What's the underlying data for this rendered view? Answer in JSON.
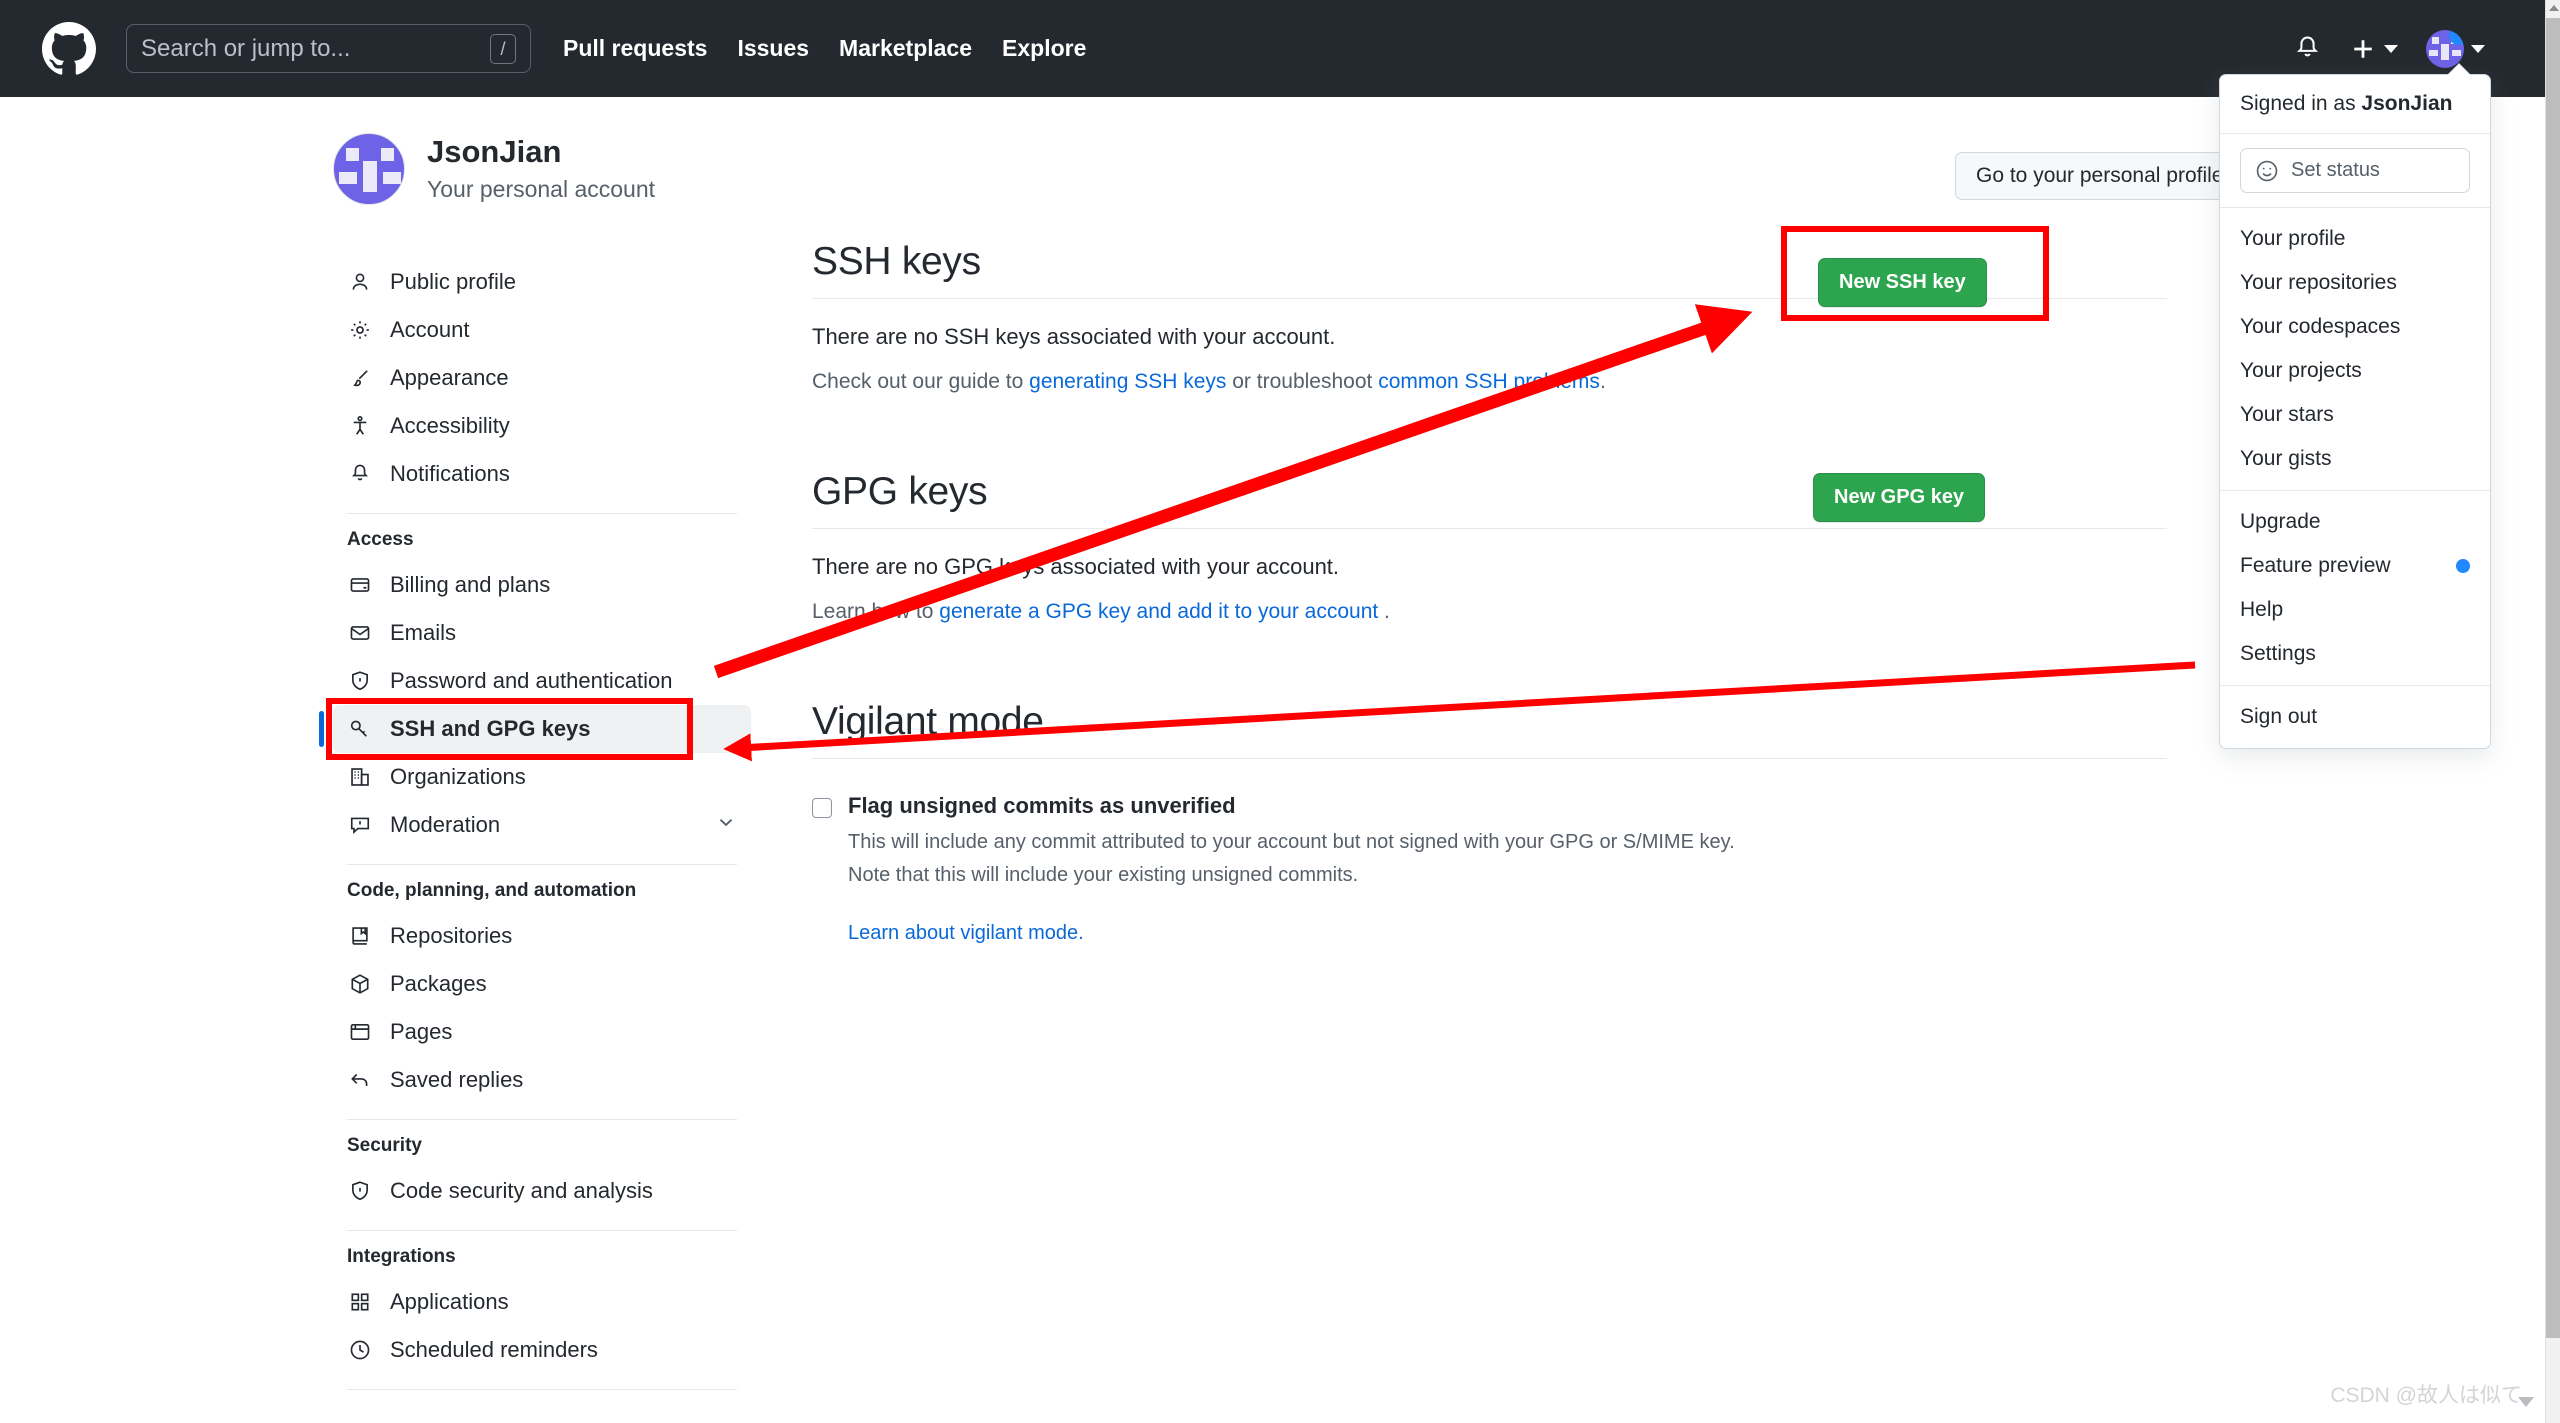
{
  "header": {
    "logo_icon": "github-logo-icon",
    "search": {
      "placeholder": "Search or jump to...",
      "shortcut": "/"
    },
    "nav": [
      {
        "label": "Pull requests"
      },
      {
        "label": "Issues"
      },
      {
        "label": "Marketplace"
      },
      {
        "label": "Explore"
      }
    ],
    "notifications_icon": "bell-icon",
    "create_new_icon": "plus-icon",
    "avatar_icon": "avatar"
  },
  "profile": {
    "name": "JsonJian",
    "subtitle": "Your personal account",
    "goto_profile_label": "Go to your personal profile"
  },
  "sidebar": {
    "top_items": [
      {
        "label": "Public profile",
        "icon": "person-icon"
      },
      {
        "label": "Account",
        "icon": "gear-icon"
      },
      {
        "label": "Appearance",
        "icon": "paintbrush-icon"
      },
      {
        "label": "Accessibility",
        "icon": "accessibility-icon"
      },
      {
        "label": "Notifications",
        "icon": "bell-icon"
      }
    ],
    "groups": [
      {
        "title": "Access",
        "items": [
          {
            "label": "Billing and plans",
            "icon": "credit-card-icon",
            "active": false
          },
          {
            "label": "Emails",
            "icon": "mail-icon",
            "active": false
          },
          {
            "label": "Password and authentication",
            "icon": "shield-lock-icon",
            "active": false
          },
          {
            "label": "SSH and GPG keys",
            "icon": "key-icon",
            "active": true
          },
          {
            "label": "Organizations",
            "icon": "organization-icon",
            "active": false
          },
          {
            "label": "Moderation",
            "icon": "report-icon",
            "active": false,
            "chevron": true
          }
        ]
      },
      {
        "title": "Code, planning, and automation",
        "items": [
          {
            "label": "Repositories",
            "icon": "repo-icon",
            "active": false
          },
          {
            "label": "Packages",
            "icon": "package-icon",
            "active": false
          },
          {
            "label": "Pages",
            "icon": "browser-icon",
            "active": false
          },
          {
            "label": "Saved replies",
            "icon": "reply-icon",
            "active": false
          }
        ]
      },
      {
        "title": "Security",
        "items": [
          {
            "label": "Code security and analysis",
            "icon": "shield-check-icon",
            "active": false
          }
        ]
      },
      {
        "title": "Integrations",
        "items": [
          {
            "label": "Applications",
            "icon": "apps-icon",
            "active": false
          },
          {
            "label": "Scheduled reminders",
            "icon": "clock-icon",
            "active": false
          }
        ]
      }
    ]
  },
  "ssh_section": {
    "title": "SSH keys",
    "empty_text": "There are no SSH keys associated with your account.",
    "guide_prefix": "Check out our guide to ",
    "guide_link1": "generating SSH keys",
    "guide_middle": " or troubleshoot ",
    "guide_link2": "common SSH problems",
    "guide_suffix": ".",
    "new_key_label": "New SSH key"
  },
  "gpg_section": {
    "title": "GPG keys",
    "empty_text": "There are no GPG keys associated with your account.",
    "guide_prefix": "Learn how to ",
    "guide_link1": "generate a GPG key and add it to your account",
    "guide_suffix": " ."
  },
  "gpg_button": {
    "new_key_label": "New GPG key"
  },
  "vigilant_section": {
    "title": "Vigilant mode",
    "checkbox_label": "Flag unsigned commits as unverified",
    "desc_line1": "This will include any commit attributed to your account but not signed with your GPG or S/MIME key.",
    "desc_line2": "Note that this will include your existing unsigned commits.",
    "learn_link": "Learn about vigilant mode."
  },
  "dropdown": {
    "signed_in_prefix": "Signed in as ",
    "signed_in_user": "JsonJian",
    "set_status_label": "Set status",
    "set_status_icon": "smiley-icon",
    "group1": [
      {
        "label": "Your profile"
      },
      {
        "label": "Your repositories"
      },
      {
        "label": "Your codespaces"
      },
      {
        "label": "Your projects"
      },
      {
        "label": "Your stars"
      },
      {
        "label": "Your gists"
      }
    ],
    "group2": [
      {
        "label": "Upgrade",
        "dot": false
      },
      {
        "label": "Feature preview",
        "dot": true
      },
      {
        "label": "Help",
        "dot": false
      },
      {
        "label": "Settings",
        "dot": false,
        "highlighted": true
      }
    ],
    "group3": [
      {
        "label": "Sign out"
      }
    ]
  },
  "watermark": {
    "text": "CSDN @故人は似て"
  },
  "colors": {
    "header_bg": "#24292f",
    "green_button": "#2da44e",
    "link_blue": "#0969da",
    "annotation_red": "#ff0000",
    "active_blue": "#0969da"
  }
}
